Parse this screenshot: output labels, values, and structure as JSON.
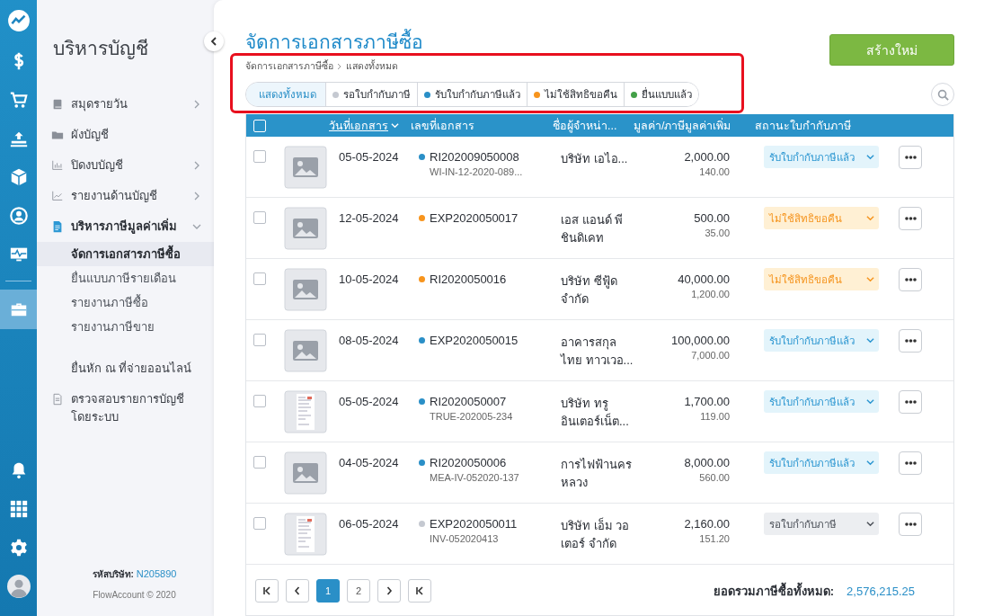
{
  "rail": {
    "items": [
      {
        "kind": "logo",
        "selected": false
      },
      {
        "kind": "dollar",
        "selected": false
      },
      {
        "kind": "cart",
        "selected": false
      },
      {
        "kind": "upload",
        "selected": false
      },
      {
        "kind": "box",
        "selected": false
      },
      {
        "kind": "contact",
        "selected": false
      },
      {
        "kind": "monitor",
        "selected": false
      },
      {
        "kind": "briefcase",
        "selected": true
      }
    ],
    "bottom_items": [
      {
        "kind": "bell"
      },
      {
        "kind": "apps"
      },
      {
        "kind": "gear"
      },
      {
        "kind": "avatar"
      }
    ]
  },
  "sidebar": {
    "title": "บริหารบัญชี",
    "items": [
      {
        "label": "สมุดรายวัน",
        "kind": "book",
        "expanded": false
      },
      {
        "label": "ผังบัญชี",
        "kind": "folder"
      },
      {
        "label": "ปิดงบบัญชี",
        "kind": "bars",
        "expanded": false
      },
      {
        "label": "รายงานด้านบัญชี",
        "kind": "trend",
        "expanded": false
      },
      {
        "label": "บริหารภาษีมูลค่าเพิ่ม",
        "kind": "doc",
        "expanded": true,
        "children": [
          {
            "label": "จัดการเอกสารภาษีซื้อ",
            "selected": true
          },
          {
            "label": "ยื่นแบบภาษีรายเดือน",
            "selected": false
          },
          {
            "label": "รายงานภาษีซื้อ",
            "selected": false
          },
          {
            "label": "รายงานภาษีขาย",
            "selected": false
          }
        ]
      },
      {
        "label": "ยื่นหัก ณ ที่จ่ายออนไลน์",
        "kind": "none"
      },
      {
        "label": "ตรวจสอบรายการบัญชีโดยระบบ",
        "kind": "doc-outline"
      }
    ],
    "footer": {
      "company_label": "รหัสบริษัท:",
      "company_code": "N205890",
      "copyright": "FlowAccount © 2020"
    }
  },
  "page": {
    "title": "จัดการเอกสารภาษีซื้อ",
    "breadcrumb": [
      "จัดการเอกสารภาษีซื้อ",
      "แสดงทั้งหมด"
    ],
    "create_button": "สร้างใหม่",
    "filters": [
      {
        "label": "แสดงทั้งหมด",
        "selected": true
      },
      {
        "label": "รอใบกำกับภาษี",
        "selected": false,
        "color": "#c5c9d1"
      },
      {
        "label": "รับใบกำกับภาษีแล้ว",
        "selected": false,
        "color": "#2a8fc7"
      },
      {
        "label": "ไม่ใช้สิทธิขอคืน",
        "selected": false,
        "color": "#f7941d"
      },
      {
        "label": "ยื่นแบบแล้ว",
        "selected": false,
        "color": "#43a047"
      }
    ],
    "table": {
      "all_checked": false,
      "columns": [
        {
          "label": "วันที่เอกสาร",
          "sorted": true
        },
        {
          "label": "เลขที่เอกสาร",
          "sorted": false
        },
        {
          "label": "ชื่อผู้จำหน่า...",
          "sorted": false
        },
        {
          "label": "มูลค่า/ภาษีมูลค่าเพิ่ม",
          "sorted": false
        },
        {
          "label": "สถานะใบกำกับภาษี",
          "sorted": false
        }
      ],
      "rows": [
        {
          "checked": false,
          "thumbnail": {
            "kind": "placeholder"
          },
          "date": "05-05-2024",
          "color": "#2a8fc7",
          "doc_no": "RI202009050008",
          "ref": "WI-IN-12-2020-089...",
          "vendor": "บริษัท เอไอ...",
          "amount": "2,000.00",
          "vat": "140.00",
          "status": {
            "label": "รับใบกำกับภาษีแล้ว",
            "kind": "received"
          }
        },
        {
          "checked": false,
          "thumbnail": {
            "kind": "placeholder"
          },
          "date": "12-05-2024",
          "color": "#f7941d",
          "doc_no": "EXP2020050017",
          "vendor": "เอส แอนด์ พี ชินดิเคท",
          "amount": "500.00",
          "vat": "35.00",
          "status": {
            "label": "ไม่ใช้สิทธิขอคืน",
            "kind": "no_claim"
          }
        },
        {
          "checked": false,
          "thumbnail": {
            "kind": "placeholder"
          },
          "date": "10-05-2024",
          "color": "#f7941d",
          "doc_no": "RI2020050016",
          "vendor": "บริษัท ซีฟู้ด จำกัด",
          "amount": "40,000.00",
          "vat": "1,200.00",
          "status": {
            "label": "ไม่ใช้สิทธิขอคืน",
            "kind": "no_claim"
          }
        },
        {
          "checked": false,
          "thumbnail": {
            "kind": "placeholder"
          },
          "date": "08-05-2024",
          "color": "#2a8fc7",
          "doc_no": "EXP2020050015",
          "vendor": "อาคารสกุล ไทย ทาวเวอ...",
          "amount": "100,000.00",
          "vat": "7,000.00",
          "status": {
            "label": "รับใบกำกับภาษีแล้ว",
            "kind": "received"
          }
        },
        {
          "checked": false,
          "thumbnail": {
            "kind": "document"
          },
          "date": "05-05-2024",
          "color": "#2a8fc7",
          "doc_no": "RI2020050007",
          "ref": "TRUE-202005-234",
          "vendor": "บริษัท ทรู อินเตอร์เน็ต...",
          "amount": "1,700.00",
          "vat": "119.00",
          "status": {
            "label": "รับใบกำกับภาษีแล้ว",
            "kind": "received"
          }
        },
        {
          "checked": false,
          "thumbnail": {
            "kind": "placeholder"
          },
          "date": "04-05-2024",
          "color": "#2a8fc7",
          "doc_no": "RI2020050006",
          "ref": "MEA-IV-052020-137",
          "vendor": "การไฟฟ้านคร หลวง",
          "amount": "8,000.00",
          "vat": "560.00",
          "status": {
            "label": "รับใบกำกับภาษีแล้ว",
            "kind": "received"
          }
        },
        {
          "checked": false,
          "thumbnail": {
            "kind": "document"
          },
          "date": "06-05-2024",
          "color": "#c5c9d1",
          "doc_no": "EXP2020050011",
          "ref": "INV-052020413",
          "vendor": "บริษัท เอ็ม วอเตอร์ จำกัด",
          "amount": "2,160.00",
          "vat": "151.20",
          "status": {
            "label": "รอใบกำกับภาษี",
            "kind": "waiting"
          }
        }
      ]
    },
    "pagination": {
      "pages": [
        {
          "label": "1",
          "selected": true
        },
        {
          "label": "2",
          "selected": false
        }
      ]
    },
    "total": {
      "label": "ยอดรวมภาษีซื้อทั้งหมด:",
      "value": "2,576,215.25"
    }
  }
}
